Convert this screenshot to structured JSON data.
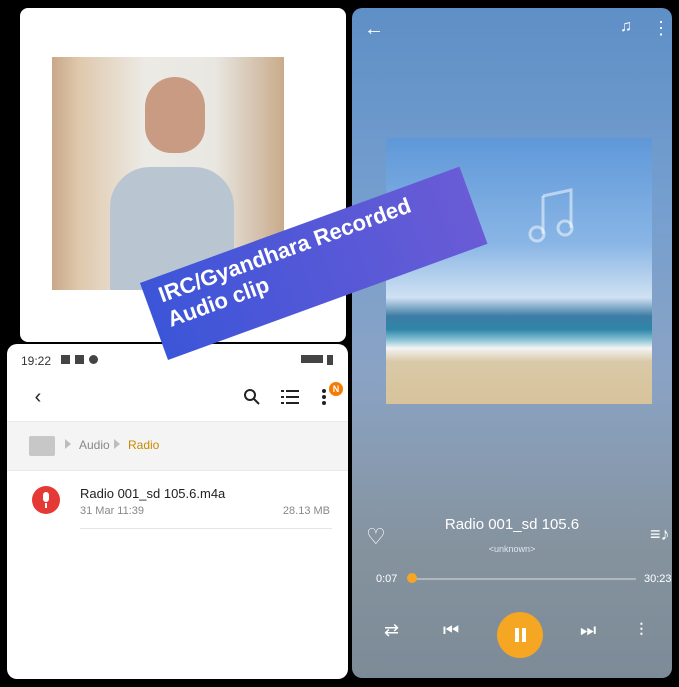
{
  "file_manager": {
    "status_time": "19:22",
    "breadcrumb": [
      "Audio",
      "Radio"
    ],
    "file": {
      "name": "Radio 001_sd 105.6.m4a",
      "date": "31 Mar 11:39",
      "size": "28.13 MB"
    },
    "notification_badge": "N"
  },
  "player": {
    "track_title": "Radio 001_sd 105.6",
    "artist": "<unknown>",
    "elapsed": "0:07",
    "total": "30:23",
    "progress_fraction": 0.004,
    "accent_color": "#f5a623"
  },
  "banner": {
    "line1": "IRC/Gyandhara Recorded",
    "line2": "Audio clip"
  },
  "icons": [
    "back-icon",
    "search-icon",
    "list-view-icon",
    "more-icon",
    "home-icon",
    "microphone-icon",
    "guitar-icon",
    "music-note-icon",
    "heart-icon",
    "queue-icon",
    "repeat-icon",
    "previous-icon",
    "pause-icon",
    "next-icon",
    "equalizer-icon"
  ]
}
